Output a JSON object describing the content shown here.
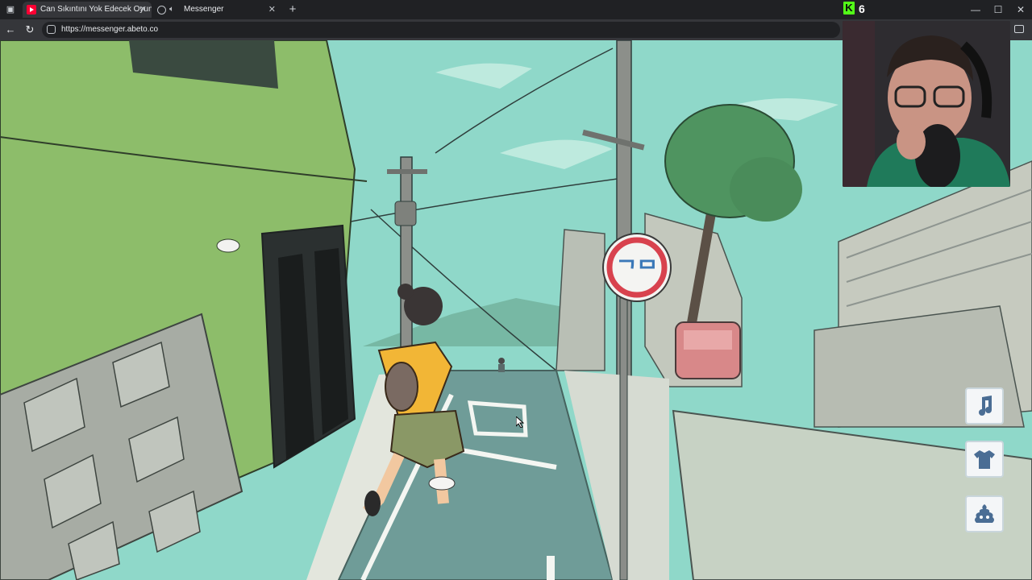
{
  "browser": {
    "tabs": [
      {
        "title": "Can Sıkıntını Yok Edecek Oyun! -",
        "favicon": "youtube-icon",
        "active": true
      },
      {
        "title": "Messenger",
        "favicon": "globe-icon",
        "audio": "speaker-icon",
        "active": false
      }
    ],
    "url": "https://messenger.abeto.co"
  },
  "overlay": {
    "kick_count": "6",
    "kick_color": "#53fc18"
  },
  "game": {
    "sign_glyph": "ᄀᄆ",
    "hud_buttons": [
      {
        "name": "music-note-icon"
      },
      {
        "name": "shirt-icon"
      },
      {
        "name": "poop-icon"
      }
    ],
    "colors": {
      "sky": "#8fd8c9",
      "building_green": "#8dbd6a",
      "road": "#6f9c98",
      "sign_red": "#d8424e"
    }
  }
}
